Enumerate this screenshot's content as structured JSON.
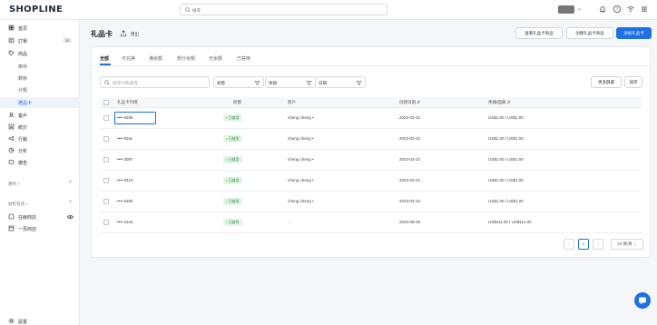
{
  "app": {
    "logo": "SHOPLINE"
  },
  "search": {
    "placeholder": "搜尋"
  },
  "sidebar": {
    "items": [
      {
        "label": "首頁",
        "icon": "home-icon"
      },
      {
        "label": "訂單",
        "icon": "order-icon",
        "badge": "20"
      },
      {
        "label": "商品",
        "icon": "tag-icon"
      }
    ],
    "product_sub": [
      {
        "label": "庫存"
      },
      {
        "label": "轉移"
      },
      {
        "label": "分類"
      },
      {
        "label": "禮品卡",
        "active": true
      }
    ],
    "items2": [
      {
        "label": "客戶",
        "icon": "user-icon"
      },
      {
        "label": "統計",
        "icon": "chart-icon"
      },
      {
        "label": "行銷",
        "icon": "megaphone-icon"
      },
      {
        "label": "分析",
        "icon": "analytics-icon"
      },
      {
        "label": "廣告",
        "icon": "ad-icon"
      }
    ],
    "apps_label": "應用 >",
    "channels_label": "銷售管道 >",
    "channels": [
      {
        "label": "在線商店",
        "icon": "store-icon"
      },
      {
        "label": "一頁商店",
        "icon": "page-icon"
      }
    ],
    "settings_label": "設置"
  },
  "header": {
    "title": "礼品卡",
    "export_label": "匯出",
    "btn_view": "查看礼品卡商品",
    "btn_create_product": "创建礼品卡商品",
    "btn_add": "添加礼品卡"
  },
  "tabs": [
    "全部",
    "可兑换",
    "满余额",
    "部分余额",
    "无余额",
    "已禁用"
  ],
  "filters": {
    "search_placeholder": "搜尋代碼/顧客",
    "status": "狀態",
    "balance": "余額",
    "date": "日期",
    "more": "更多篩選",
    "sort": "排序"
  },
  "table": {
    "headers": {
      "code": "礼品卡代碼",
      "status": "狀態",
      "customer": "客戶",
      "created": "创建日期",
      "balance": "余額/面額"
    },
    "rows": [
      {
        "code": "•••• 9296",
        "status": "• 已啟用",
        "customer": "cheng cheng •",
        "created": "2023-03-22",
        "balance": "US$1.00 / US$1.00"
      },
      {
        "code": "•••• 82ac",
        "status": "• 已啟用",
        "customer": "cheng cheng •",
        "created": "2023-03-22",
        "balance": "US$1.00 / US$1.00"
      },
      {
        "code": "•••• 3097",
        "status": "• 已啟用",
        "customer": "cheng cheng •",
        "created": "2023-03-22",
        "balance": "US$1.00 / US$1.00"
      },
      {
        "code": "•••• 8410",
        "status": "• 已啟用",
        "customer": "cheng cheng •",
        "created": "2023-03-22",
        "balance": "US$1.00 / US$1.00"
      },
      {
        "code": "•••• 520b",
        "status": "• 已啟用",
        "customer": "cheng cheng •",
        "created": "2023-03-22",
        "balance": "US$1.00 / US$1.00"
      },
      {
        "code": "•••• 61e4",
        "status": "• 已啟用",
        "customer": "-",
        "created": "2023-08-08",
        "balance": "US$111.00 / US$111.00"
      }
    ]
  },
  "pagination": {
    "page": "1",
    "page_size": "20 條/頁",
    "prev": "‹",
    "next": "›"
  },
  "colors": {
    "accent": "#1f6fe5",
    "status_bg": "#e4f5e8",
    "status_fg": "#2e8b45"
  }
}
